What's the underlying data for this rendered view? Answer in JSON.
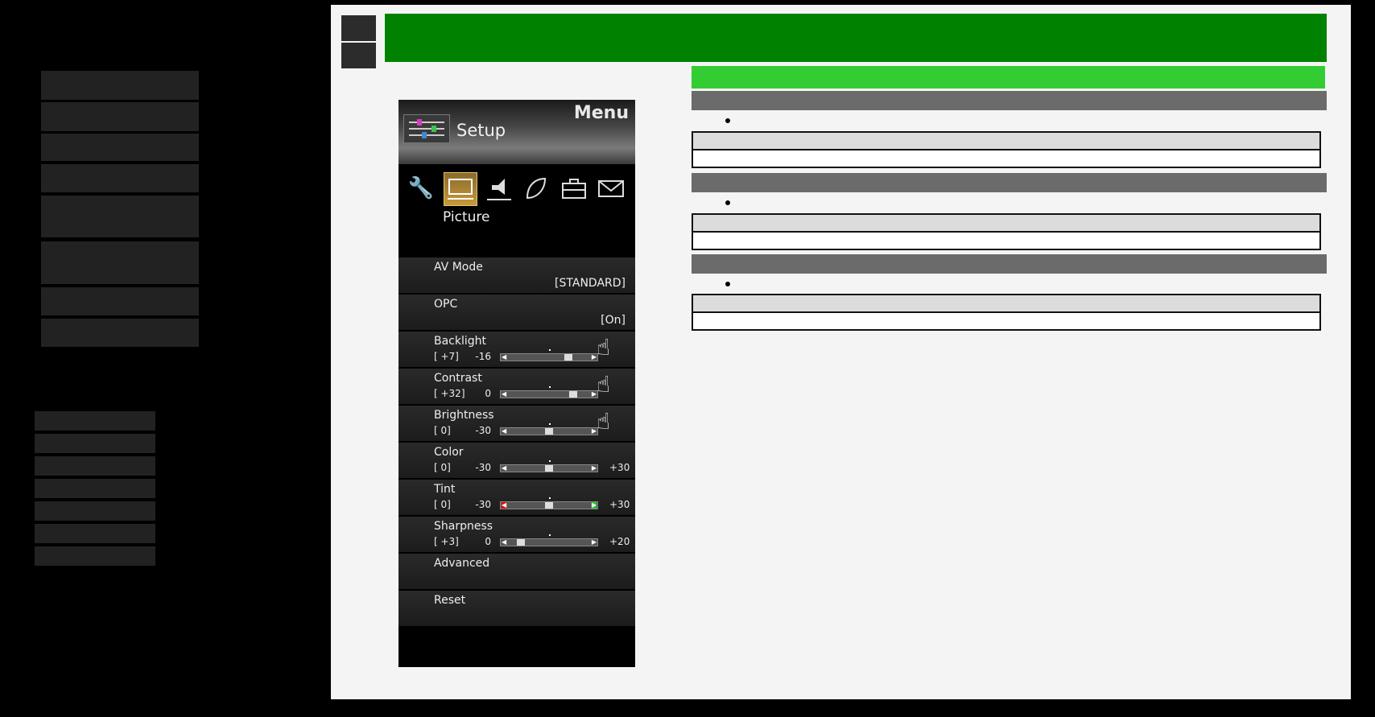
{
  "tv_menu": {
    "title": "Menu",
    "header_label": "Setup",
    "selected_category": "Picture",
    "category_icons": [
      "wrench-icon",
      "picture-icon",
      "speaker-icon",
      "leaf-icon",
      "toolbox-icon",
      "envelope-icon"
    ],
    "items": [
      {
        "label": "AV Mode",
        "value": "[STANDARD]"
      },
      {
        "label": "OPC",
        "value": "[On]"
      },
      {
        "label": "Backlight",
        "current": "[    +7]",
        "min": "-16",
        "max": "",
        "level": 0.74
      },
      {
        "label": "Contrast",
        "current": "[ +32]",
        "min": "0",
        "max": "",
        "level": 0.8
      },
      {
        "label": "Brightness",
        "current": "[     0]",
        "min": "-30",
        "max": "",
        "level": 0.5
      },
      {
        "label": "Color",
        "current": "[     0]",
        "min": "-30",
        "max": "+30",
        "level": 0.5
      },
      {
        "label": "Tint",
        "current": "[     0]",
        "min": "-30",
        "max": "+30",
        "level": 0.5
      },
      {
        "label": "Sharpness",
        "current": "[    +3]",
        "min": "0",
        "max": "+20",
        "level": 0.15
      },
      {
        "label": "Advanced"
      },
      {
        "label": "Reset"
      }
    ]
  },
  "colors": {
    "header_green": "#008200",
    "subheader_green": "#33cc33",
    "section_gray": "#6b6b6b",
    "content_bg": "#f4f4f4"
  }
}
